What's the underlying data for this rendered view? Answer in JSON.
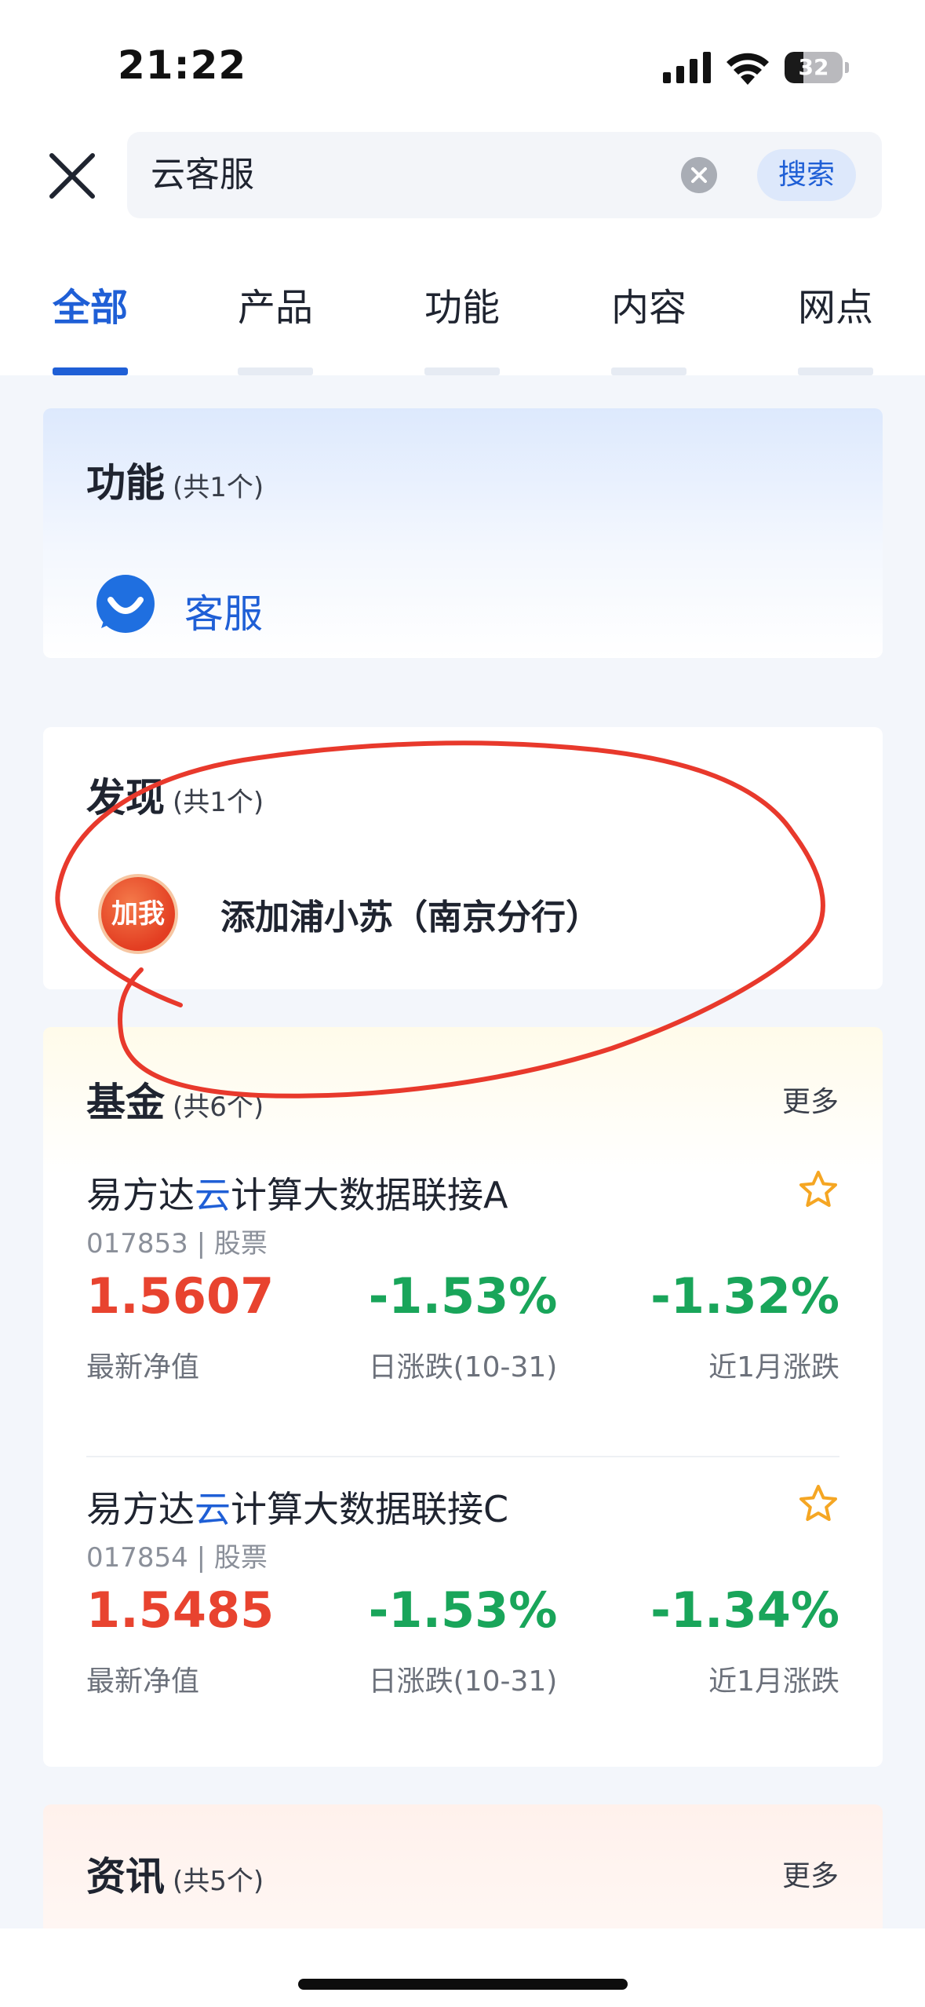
{
  "status_bar": {
    "time": "21:22",
    "battery": "32",
    "battery_level": 0.32
  },
  "search": {
    "query": "云客服",
    "button_label": "搜索"
  },
  "tabs": [
    {
      "label": "全部",
      "active": true
    },
    {
      "label": "产品",
      "active": false
    },
    {
      "label": "功能",
      "active": false
    },
    {
      "label": "内容",
      "active": false
    },
    {
      "label": "网点",
      "active": false
    }
  ],
  "function_section": {
    "title": "功能",
    "count": "(共1个)",
    "item_label": "客服"
  },
  "discover_section": {
    "title": "发现",
    "count": "(共1个)",
    "avatar_text": "加我",
    "item_label": "添加浦小苏（南京分行）"
  },
  "fund_section": {
    "title": "基金",
    "count": "(共6个)",
    "more": "更多",
    "funds": [
      {
        "name_prefix": "易方达",
        "name_highlight": "云",
        "name_suffix": "计算大数据联接A",
        "meta": "017853 | 股票",
        "nav": "1.5607",
        "day_change": "-1.53%",
        "month_change": "-1.32%",
        "nav_label": "最新净值",
        "day_label": "日涨跌(10-31)",
        "month_label": "近1月涨跌"
      },
      {
        "name_prefix": "易方达",
        "name_highlight": "云",
        "name_suffix": "计算大数据联接C",
        "meta": "017854 | 股票",
        "nav": "1.5485",
        "day_change": "-1.53%",
        "month_change": "-1.34%",
        "nav_label": "最新净值",
        "day_label": "日涨跌(10-31)",
        "month_label": "近1月涨跌"
      }
    ]
  },
  "news_section": {
    "title": "资讯",
    "count": "(共5个)",
    "more": "更多"
  },
  "icons": {
    "close": "close-icon",
    "clear": "clear-icon",
    "service": "customer-service-icon",
    "star": "star-outline-icon",
    "signal": "cellular-signal-icon",
    "wifi": "wifi-icon"
  },
  "colors": {
    "accent": "#1f5fd6",
    "price_up": "#e8432f",
    "price_down": "#19a55a",
    "star": "#f5a623",
    "annotation": "#e8392c"
  }
}
